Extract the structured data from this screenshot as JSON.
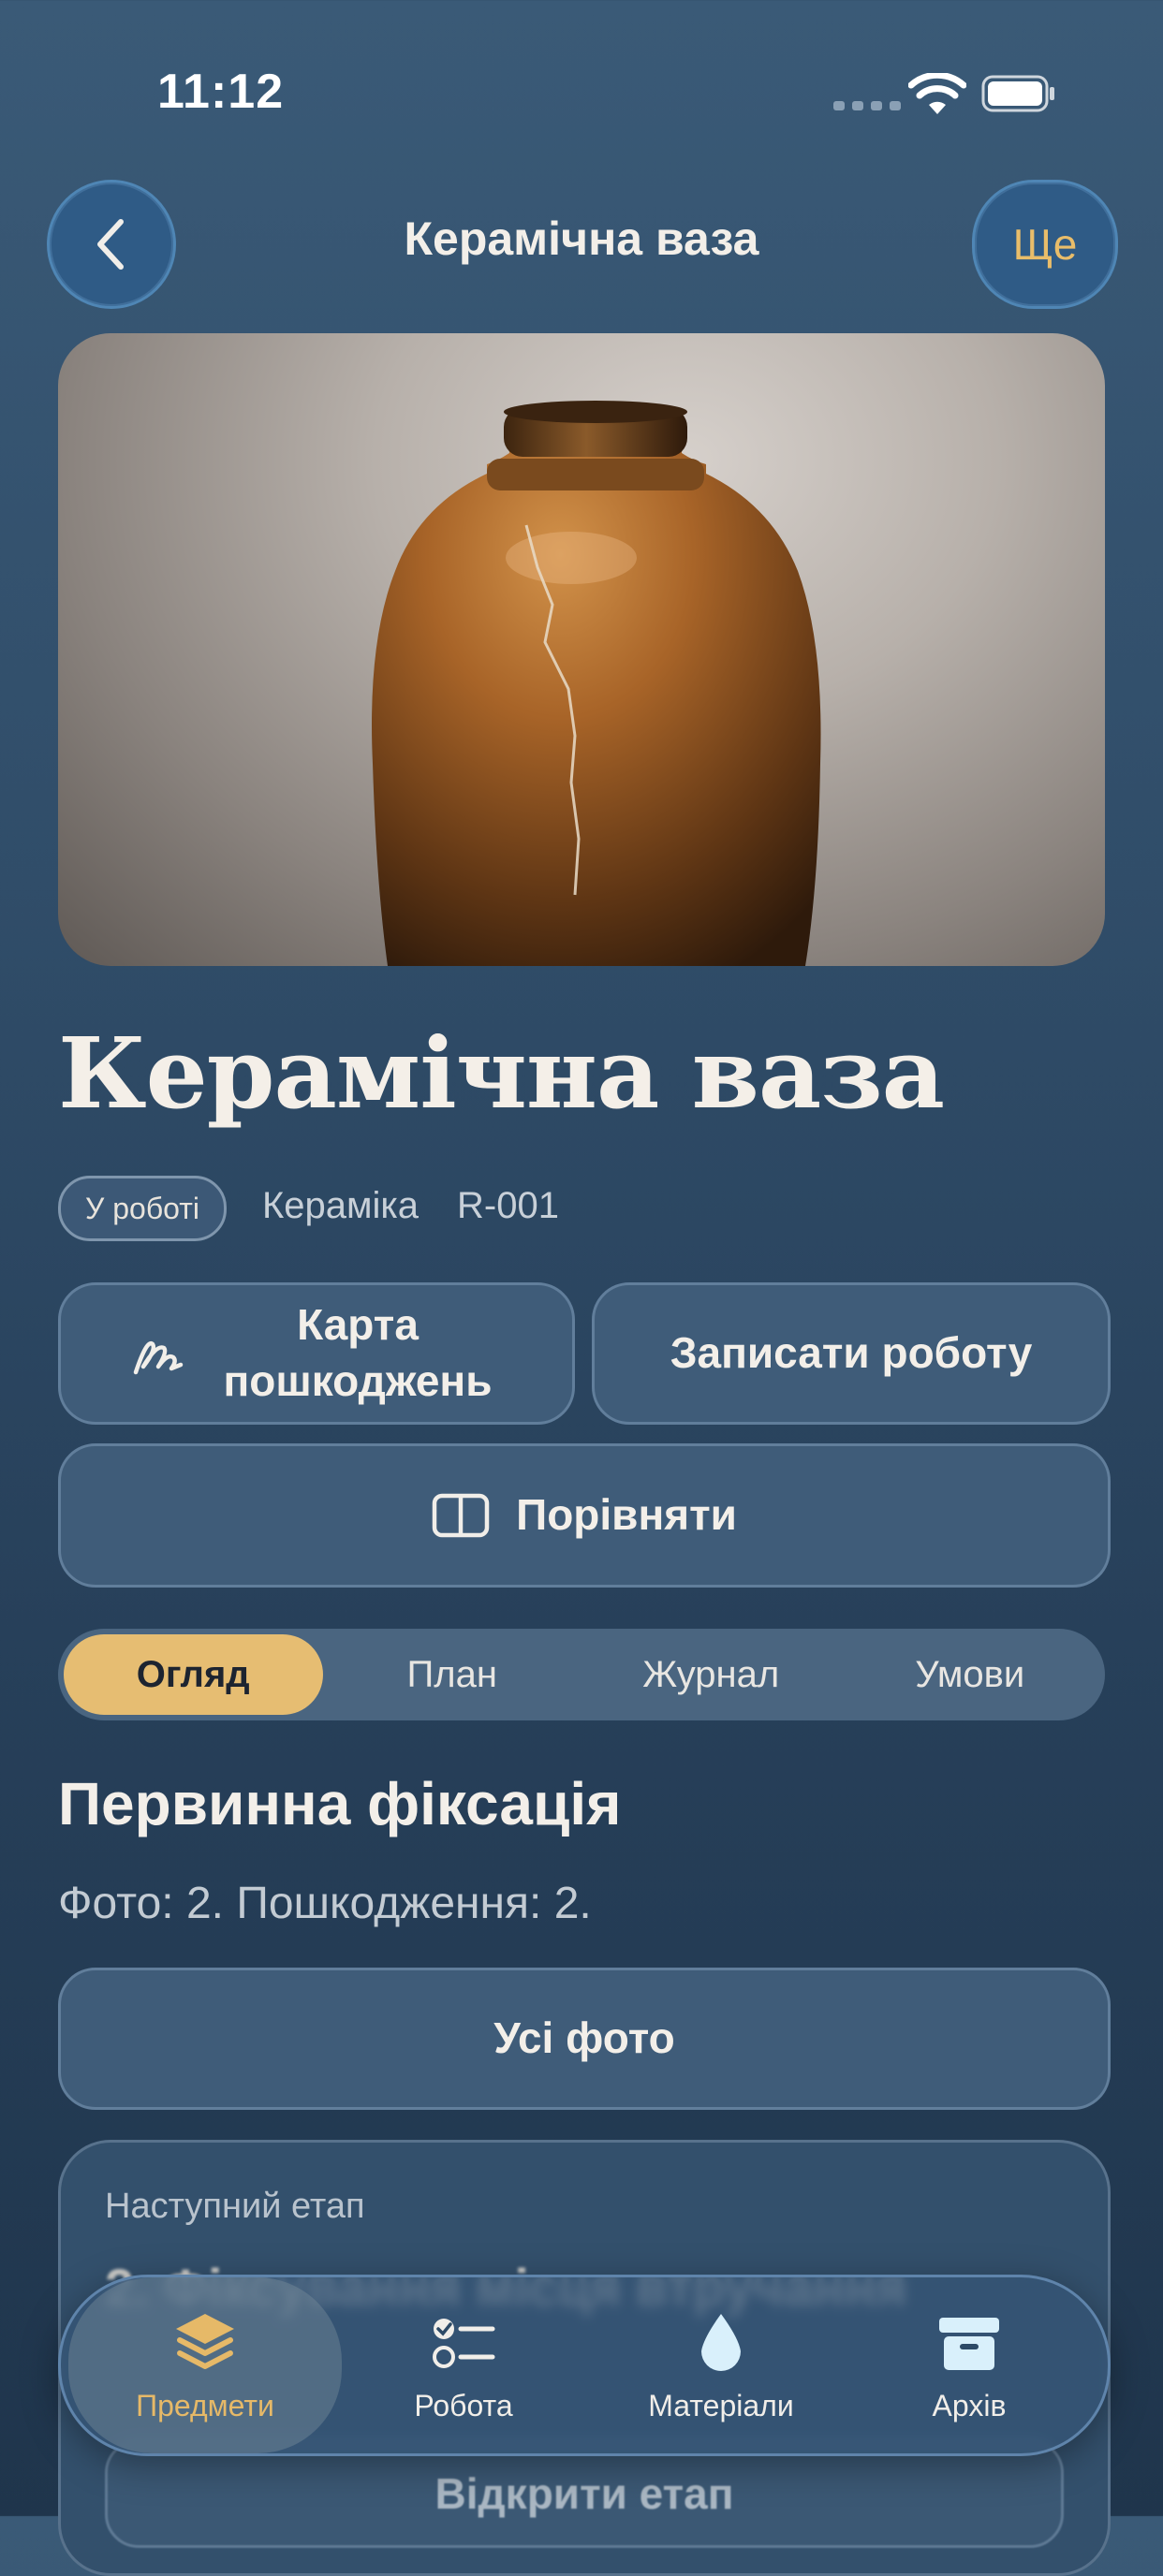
{
  "status": {
    "time": "11:12"
  },
  "nav": {
    "title": "Керамічна ваза",
    "more_label": "Ще"
  },
  "item": {
    "title": "Керамічна ваза",
    "status_badge": "У роботі",
    "category": "Кераміка",
    "code": "R-001"
  },
  "actions": {
    "damage_map": "Карта пошкоджень",
    "record_work": "Записати роботу",
    "compare": "Порівняти"
  },
  "segments": [
    {
      "label": "Огляд",
      "active": true
    },
    {
      "label": "План",
      "active": false
    },
    {
      "label": "Журнал",
      "active": false
    },
    {
      "label": "Умови",
      "active": false
    }
  ],
  "section": {
    "title": "Первинна фіксація",
    "subtitle": "Фото: 2. Пошкодження: 2.",
    "all_photos": "Усі фото"
  },
  "next_stage": {
    "label": "Наступний етап",
    "title": "2. Фіксування місця втручання",
    "button": "Відкрити етап"
  },
  "tabbar": [
    {
      "label": "Предмети",
      "icon": "layers-icon",
      "active": true
    },
    {
      "label": "Робота",
      "icon": "checklist-icon",
      "active": false
    },
    {
      "label": "Матеріали",
      "icon": "drop-icon",
      "active": false
    },
    {
      "label": "Архів",
      "icon": "archive-icon",
      "active": false
    }
  ],
  "colors": {
    "accent": "#E6BD72",
    "background": "#2F4B67"
  }
}
